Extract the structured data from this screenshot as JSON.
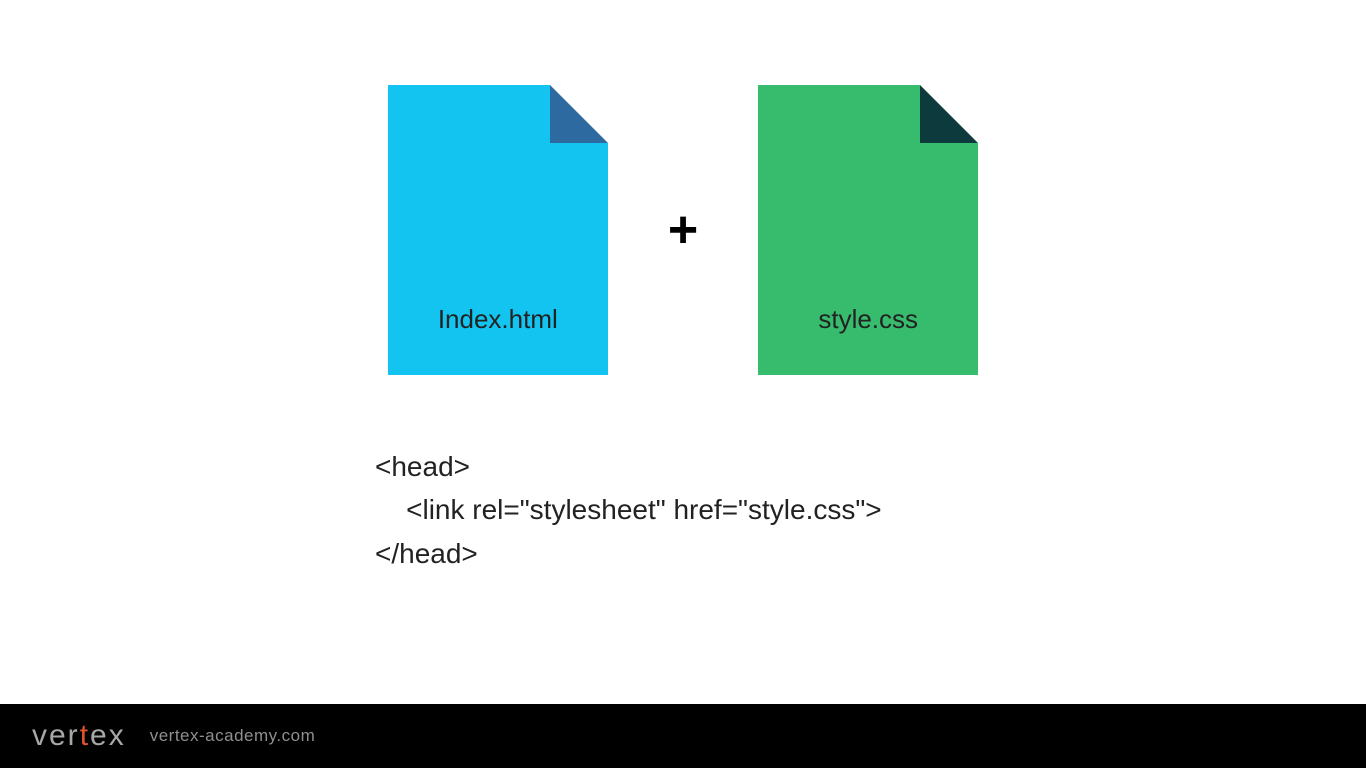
{
  "files": {
    "html_label": "Index.html",
    "css_label": "style.css",
    "plus": "+"
  },
  "code": {
    "line1": "<head>",
    "line2": "    <link rel=\"stylesheet\" href=\"style.css\">",
    "line3": "</head>"
  },
  "footer": {
    "logo_pre": "ver",
    "logo_accent": "t",
    "logo_post": "ex",
    "url": "vertex-academy.com"
  },
  "colors": {
    "html_file": "#13c4f0",
    "html_fold": "#2d6aa0",
    "css_file": "#37bc6e",
    "css_fold": "#0d3b3d",
    "accent": "#e0542d"
  }
}
